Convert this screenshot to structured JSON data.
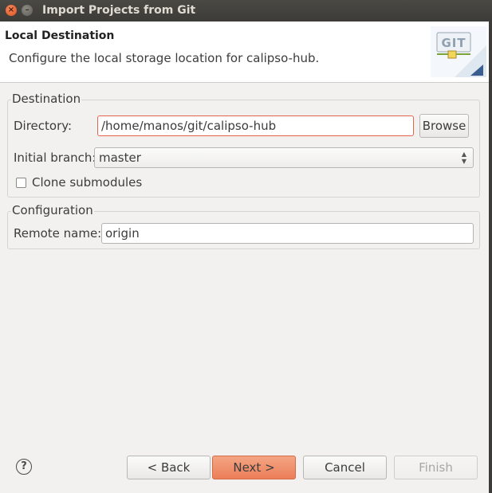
{
  "window": {
    "title": "Import Projects from Git",
    "controls": [
      "close-icon",
      "minimize-icon"
    ]
  },
  "header": {
    "title": "Local Destination",
    "description": "Configure the local storage location for calipso-hub.",
    "logo_text": "GIT"
  },
  "destination": {
    "legend": "Destination",
    "directory_label": "Directory:",
    "directory_value": "/home/manos/git/calipso-hub",
    "browse_label": "Browse",
    "branch_label": "Initial branch:",
    "branch_value": "master",
    "clone_submodules_label": "Clone submodules",
    "clone_submodules_checked": false
  },
  "configuration": {
    "legend": "Configuration",
    "remote_label": "Remote name:",
    "remote_value": "origin"
  },
  "footer": {
    "help_icon": "help-icon",
    "back_label": "< Back",
    "next_label": "Next >",
    "cancel_label": "Cancel",
    "finish_label": "Finish",
    "finish_enabled": false
  },
  "colors": {
    "accent": "#ec7e58",
    "titlebar": "#3c3b37",
    "background": "#f2f1f0"
  }
}
